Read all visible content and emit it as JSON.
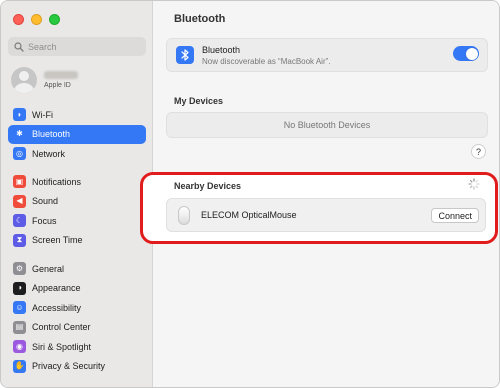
{
  "sidebar": {
    "search": {
      "placeholder": "Search"
    },
    "apple_id": {
      "label": "Apple ID"
    },
    "groups": [
      [
        {
          "label": "Wi-Fi",
          "icon": "wifi-icon",
          "color": "#3478f6",
          "selected": false
        },
        {
          "label": "Bluetooth",
          "icon": "bluetooth-icon",
          "color": "#3478f6",
          "selected": true
        },
        {
          "label": "Network",
          "icon": "globe-icon",
          "color": "#3478f6",
          "selected": false
        }
      ],
      [
        {
          "label": "Notifications",
          "icon": "bell-icon",
          "color": "#f04c3b",
          "selected": false
        },
        {
          "label": "Sound",
          "icon": "speaker-icon",
          "color": "#f04c3b",
          "selected": false
        },
        {
          "label": "Focus",
          "icon": "moon-icon",
          "color": "#5e5ce6",
          "selected": false
        },
        {
          "label": "Screen Time",
          "icon": "hourglass-icon",
          "color": "#5e5ce6",
          "selected": false
        }
      ],
      [
        {
          "label": "General",
          "icon": "gear-icon",
          "color": "#8e8e93",
          "selected": false
        },
        {
          "label": "Appearance",
          "icon": "appearance-icon",
          "color": "#1d1d1f",
          "selected": false
        },
        {
          "label": "Accessibility",
          "icon": "accessibility-icon",
          "color": "#3478f6",
          "selected": false
        },
        {
          "label": "Control Center",
          "icon": "control-center-icon",
          "color": "#8e8e93",
          "selected": false
        },
        {
          "label": "Siri & Spotlight",
          "icon": "siri-icon",
          "color": "#9b59e0",
          "selected": false
        },
        {
          "label": "Privacy & Security",
          "icon": "hand-icon",
          "color": "#3478f6",
          "selected": false
        }
      ]
    ]
  },
  "main": {
    "title": "Bluetooth",
    "bluetooth": {
      "name": "Bluetooth",
      "subtitle": "Now discoverable as “MacBook Air”.",
      "enabled": true
    },
    "my_devices": {
      "heading": "My Devices",
      "empty_text": "No Bluetooth Devices"
    },
    "help_label": "?",
    "nearby": {
      "heading": "Nearby Devices",
      "device_name": "ELECOM OpticalMouse",
      "connect_label": "Connect"
    }
  },
  "colors": {
    "accent": "#3478f6",
    "highlight_border": "#e01c1c"
  }
}
